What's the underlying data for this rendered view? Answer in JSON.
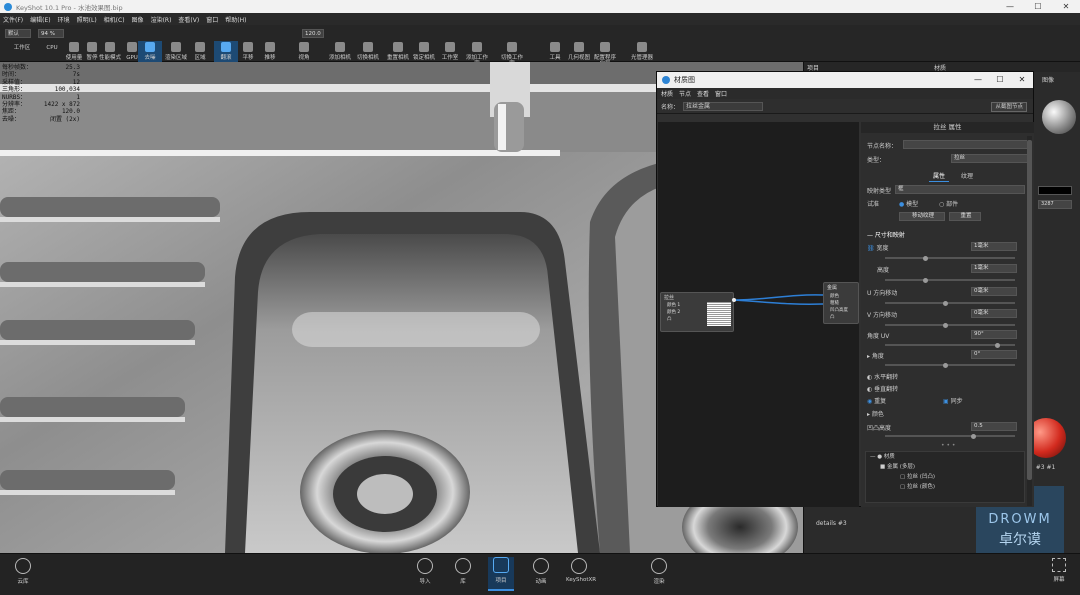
{
  "titlebar": {
    "title": "KeyShot 10.1 Pro - 水池效果图.bip",
    "min": "—",
    "max": "☐",
    "close": "✕"
  },
  "menubar": [
    "文件(F)",
    "编辑(E)",
    "环境",
    "照明(L)",
    "相机(C)",
    "图像",
    "渲染(R)",
    "查看(V)",
    "窗口",
    "帮助(H)"
  ],
  "toolbar": {
    "workspace_value": "默认",
    "percent_value": "94 %",
    "num_value": "120.0",
    "items": [
      "工作区",
      "CPU",
      "使用量",
      "暂停",
      "性能模式",
      "GPU",
      "去噪",
      "渲染区域",
      "区域",
      "翻滚",
      "平移",
      "推移",
      "视角",
      "添加相机",
      "切换相机",
      "重置相机",
      "锁定相机",
      "工作室",
      "添加工作室",
      "切换工作室",
      "工具",
      "几何视图",
      "配置程序向导",
      "光管理器"
    ]
  },
  "stats": [
    [
      "每秒帧数：",
      "25.3"
    ],
    [
      "时间：",
      "7s"
    ],
    [
      "采样值：",
      "12"
    ],
    [
      "三角形：",
      "100,034"
    ],
    [
      "NURBS：",
      "1"
    ],
    [
      "分辨率：",
      "1422 x 872"
    ],
    [
      "焦距：",
      "120.0"
    ],
    [
      "去噪：",
      "闭置 (2x)"
    ]
  ],
  "bottombar": [
    "云库",
    "导入",
    "库",
    "项目",
    "动画",
    "KeyShotXR",
    "渲染"
  ],
  "rightpanel": {
    "col1": "项目",
    "col2": "材质",
    "label": "图像",
    "thumb_label": "details #3",
    "thumb_label2": "ls #3 #1",
    "watermark": "DROWM",
    "watermark_cn": "卓尔谟",
    "screenshot": "屏幕"
  },
  "dialog": {
    "title": "材质图",
    "menu": [
      "材质",
      "节点",
      "查看",
      "窗口"
    ],
    "name_label": "名称：",
    "name_value": "拉丝金属",
    "toolbar_btn": "从截图节点",
    "props_header": "拉丝 属性",
    "node_name_label": "节点名称：",
    "type_label": "类型：",
    "type_value": "拉丝",
    "tab_props": "属性",
    "tab_texture": "纹理",
    "mapping_label": "映射类型",
    "mapping_value": "框",
    "shader_label": "试准",
    "radio_model": "模型",
    "radio_part": "部件",
    "btn_move": "移动纹理",
    "btn_reset": "重置",
    "section_size": "尺寸和映射",
    "width_label": "宽度",
    "width_value": "1毫米",
    "height_label": "高度",
    "height_value": "1毫米",
    "u_label": "U 方向移动",
    "u_value": "0毫米",
    "v_label": "V 方向移动",
    "v_value": "0毫米",
    "angle_uv_label": "角度 UV",
    "angle_uv_value": "90°",
    "angle_label": "角度",
    "angle_value": "0°",
    "flip_h": "水平翻转",
    "flip_v": "垂直翻转",
    "repeat": "重复",
    "sync": "同步",
    "section_color": "颜色",
    "bump_label": "凹凸高度",
    "bump_value": "0.5",
    "tree": [
      "材质",
      "金属 (多层)",
      "拉丝 (凹凸)",
      "拉丝 (颜色)"
    ],
    "node_left_title": "拉丝",
    "node_left_ports": [
      "颜色 1",
      "颜色 2",
      "凸"
    ],
    "node_right_title": "金属",
    "node_right_ports": [
      "颜色",
      "粗糙",
      "凹凸高度",
      "凸"
    ]
  },
  "colors": {
    "accent": "#3c8fe0",
    "panel": "#2e2e2e",
    "bg": "#1b1b1b"
  }
}
